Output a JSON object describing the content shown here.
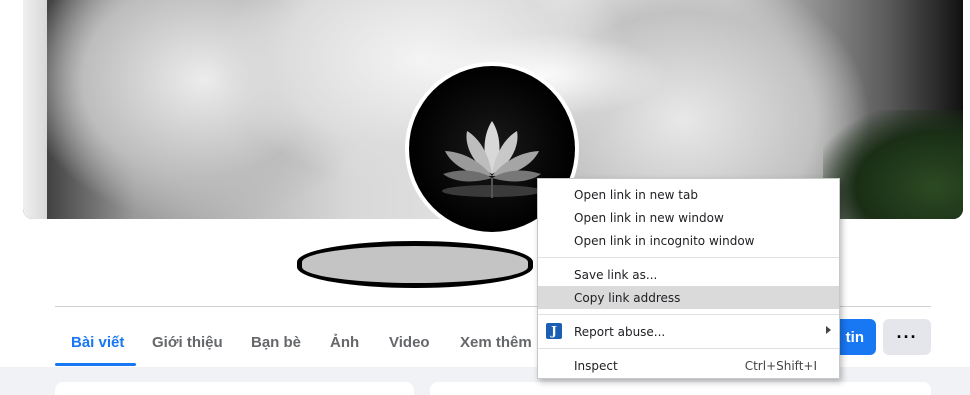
{
  "profile": {
    "cover_alt": "white lotus cover photo",
    "avatar_alt": "lotus profile picture"
  },
  "tabs": [
    {
      "label": "Bài viết",
      "active": true
    },
    {
      "label": "Giới thiệu",
      "active": false
    },
    {
      "label": "Bạn bè",
      "active": false
    },
    {
      "label": "Ảnh",
      "active": false
    },
    {
      "label": "Video",
      "active": false
    },
    {
      "label": "Xem thêm",
      "active": false
    }
  ],
  "actions": {
    "primary_label": "tin",
    "more_label": "···"
  },
  "context_menu": {
    "items": [
      {
        "label": "Open link in new tab"
      },
      {
        "label": "Open link in new window"
      },
      {
        "label": "Open link in incognito window"
      },
      {
        "label": "Save link as..."
      },
      {
        "label": "Copy link address",
        "highlighted": true
      },
      {
        "label": "Report abuse...",
        "icon": "extension-j-icon",
        "has_submenu": true
      },
      {
        "label": "Inspect",
        "shortcut": "Ctrl+Shift+I"
      }
    ]
  },
  "colors": {
    "accent": "#1877f2",
    "tab_inactive": "#65676b",
    "menu_highlight": "#dadada"
  }
}
